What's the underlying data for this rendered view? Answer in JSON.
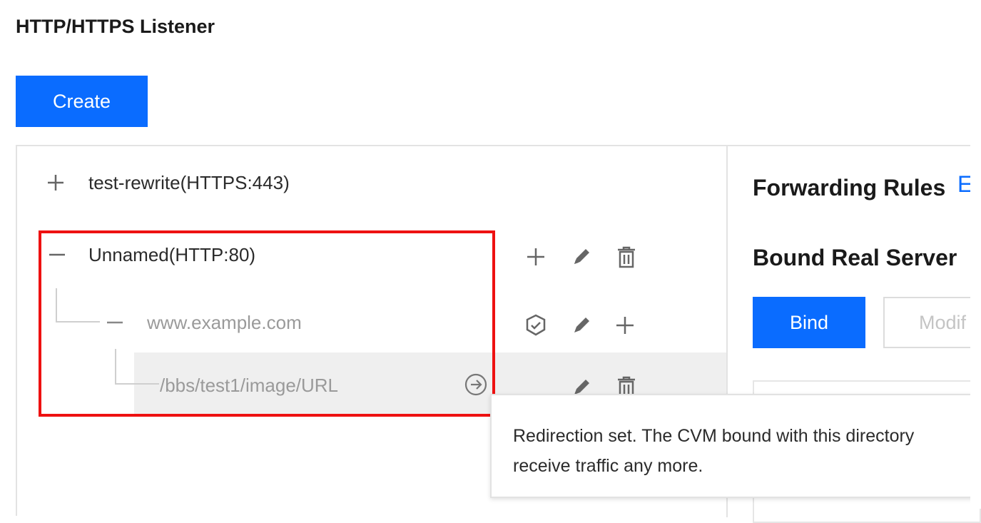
{
  "header": {
    "title": "HTTP/HTTPS Listener"
  },
  "toolbar": {
    "create_label": "Create"
  },
  "tree": {
    "listener_1": {
      "label": "test-rewrite(HTTPS:443)",
      "toggle": "plus"
    },
    "listener_2": {
      "label": "Unnamed(HTTP:80)",
      "toggle": "minus"
    },
    "domain": {
      "label": "www.example.com",
      "toggle": "minus"
    },
    "url": {
      "label": "/bbs/test1/image/URL"
    }
  },
  "right_panel": {
    "forwarding_title": "Forwarding Rules",
    "forwarding_link_fragment": "E",
    "bound_title": "Bound Real Server",
    "bind_label": "Bind",
    "modify_label": "Modif"
  },
  "tooltip": {
    "line1": "Redirection set. The CVM bound with this directory",
    "line2": "receive traffic any more."
  },
  "colors": {
    "primary": "#0a6cff",
    "highlight_border": "#ee1111"
  }
}
